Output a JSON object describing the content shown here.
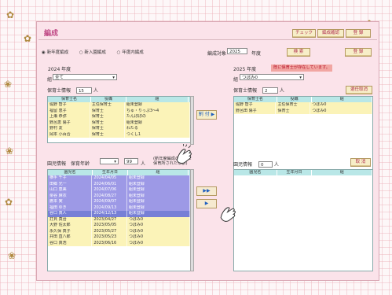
{
  "toolbar": {
    "check": "チェック",
    "reference": "編成確認",
    "register": "登 録",
    "search": "検 索",
    "edit": "登 録"
  },
  "title": "編成",
  "mode": {
    "option1": "新年度編成",
    "option2": "新入園編成",
    "option3": "年度内編成",
    "target_label": "編成対象",
    "year": "2025",
    "unit": "年度"
  },
  "left_panel": {
    "year_label": "2024 年度",
    "group_label": "組",
    "group_value": "全て",
    "staff_label": "保育士情報",
    "staff_count": "15",
    "person_unit": "人",
    "table_headers": [
      "保育士名",
      "役職",
      "組"
    ],
    "rows": [
      [
        "堀野 智子",
        "主任保育士",
        "組未登録"
      ],
      [
        "福留 恵子",
        "保育士",
        "ちゅ・りっぷ3～4"
      ],
      [
        "上瀬 恭弥",
        "保育士",
        "たんぽぽの"
      ],
      [
        "野呂恵 陽子",
        "保育士",
        "組未登録"
      ],
      [
        "野村 友",
        "保育士",
        "わたる"
      ],
      [
        "岡本 小百合",
        "保育士",
        "つくし1"
      ]
    ]
  },
  "right_panel": {
    "year_label": "2025 年度",
    "warn": "既に保育士が存在しています。",
    "group_label": "組",
    "group_value": "つぼみ0",
    "staff_label": "保育士情報",
    "staff_count": "2",
    "person_unit": "人",
    "cancel_button": "選任取消",
    "table_headers": [
      "保育士名",
      "役職",
      "組"
    ],
    "rows": [
      [
        "堀野 智子",
        "主任保育士",
        "つぼみ0"
      ],
      [
        "野呂田 陽子",
        "保育士",
        "つぼみ0"
      ]
    ]
  },
  "children_left": {
    "label": "園児情報",
    "filter_label": "保育年齢",
    "count": "99",
    "person_unit": "人",
    "note": "(新年度編成の年齢に 保育所された年齢)",
    "table_headers": [
      "園児名",
      "生年月日",
      "組"
    ],
    "rows": [
      [
        "横手 千子",
        "2024/04/05",
        "組未登録"
      ],
      [
        "田郷 光一",
        "2024/06/01",
        "組未登録"
      ],
      [
        "山口 恵美",
        "2024/07/06",
        "組未登録"
      ],
      [
        "栗谷 麻衣",
        "2024/08/27",
        "組未登録"
      ],
      [
        "鷹本 実",
        "2024/09/07",
        "組未登録"
      ],
      [
        "福田 ゆき",
        "2024/09/13",
        "組未登録"
      ],
      [
        "谷口 真人",
        "2024/12/13",
        "組未登録"
      ],
      [
        "打貝 真治",
        "2023/04/27",
        "つぼみ0"
      ],
      [
        "大野 佐太郎",
        "2023/05/05",
        "つぼみ0"
      ],
      [
        "永久保 真子",
        "2023/05/27",
        "つぼみ0"
      ],
      [
        "井田 直八郎",
        "2023/05/23",
        "つぼみ0"
      ],
      [
        "谷口 真浩",
        "2023/06/16",
        "つぼみ0"
      ]
    ]
  },
  "children_right": {
    "label": "園児情報",
    "count": "0",
    "person_unit": "人",
    "cancel_button": "取 消",
    "table_headers": [
      "園児名",
      "生年月日",
      "組"
    ]
  },
  "arrows": {
    "assign": "割 付 ▶",
    "double": "▶▶",
    "single": "▶"
  }
}
